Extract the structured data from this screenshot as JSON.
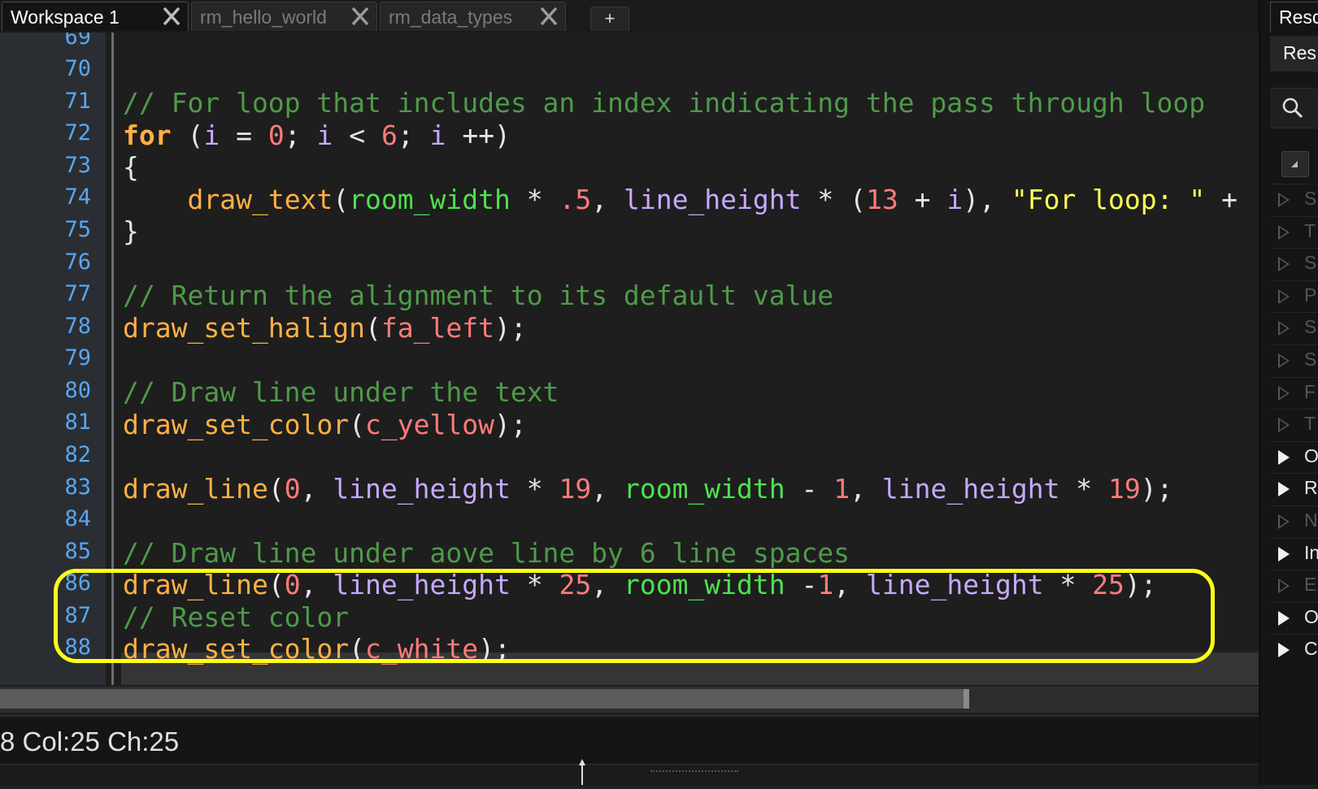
{
  "tabs": [
    {
      "label": "Workspace 1",
      "active": true
    },
    {
      "label": "rm_hello_world",
      "active": false
    },
    {
      "label": "rm_data_types",
      "active": false
    }
  ],
  "tab_add_label": "+",
  "editor": {
    "line_numbers": [
      "69",
      "70",
      "71",
      "72",
      "73",
      "74",
      "75",
      "76",
      "77",
      "78",
      "79",
      "80",
      "81",
      "82",
      "83",
      "84",
      "85",
      "86",
      "87",
      "88"
    ],
    "current_line": "88"
  },
  "status": {
    "text": "8 Col:25 Ch:25"
  },
  "right_panel": {
    "tab_label": "Resc",
    "header_label": "Res",
    "items": [
      {
        "letter": "S",
        "bright": false
      },
      {
        "letter": "T",
        "bright": false
      },
      {
        "letter": "S",
        "bright": false
      },
      {
        "letter": "P",
        "bright": false
      },
      {
        "letter": "S",
        "bright": false
      },
      {
        "letter": "S",
        "bright": false
      },
      {
        "letter": "F",
        "bright": false
      },
      {
        "letter": "T",
        "bright": false
      },
      {
        "letter": "O",
        "bright": true
      },
      {
        "letter": "R",
        "bright": true
      },
      {
        "letter": "N",
        "bright": false
      },
      {
        "letter": "In",
        "bright": true
      },
      {
        "letter": "E",
        "bright": false
      },
      {
        "letter": "O",
        "bright": true
      },
      {
        "letter": "C",
        "bright": true
      }
    ]
  },
  "colors": {
    "comment": "#4f9a4a",
    "keyword": "#ffb046",
    "variable": "#c8a8ff",
    "number": "#ff7b7b",
    "string": "#ffff55",
    "builtin": "#4ee04e",
    "line_number": "#5aa6f0",
    "highlight_box": "#ffff1a"
  }
}
